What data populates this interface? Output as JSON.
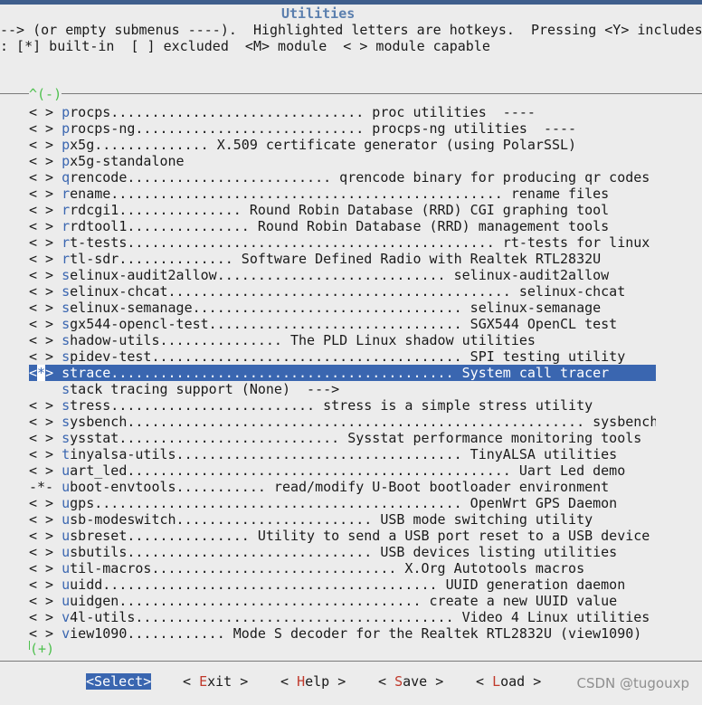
{
  "window": {
    "title": "Utilities"
  },
  "help": {
    "line1": "--> (or empty submenus ----).  Highlighted letters are hotkeys.  Pressing <Y> includes,",
    "line2": ": [*] built-in  [ ] excluded  <M> module  < > module capable"
  },
  "scroll": {
    "up_indicator": "^(-)",
    "down_indicator": "(+)"
  },
  "items": [
    {
      "prefix": "< > ",
      "hotkey": "p",
      "rest": "rocps............................... proc utilities  ----"
    },
    {
      "prefix": "< > ",
      "hotkey": "p",
      "rest": "rocps-ng............................ procps-ng utilities  ----"
    },
    {
      "prefix": "< > ",
      "hotkey": "p",
      "rest": "x5g.............. X.509 certificate generator (using PolarSSL)"
    },
    {
      "prefix": "< > ",
      "hotkey": "p",
      "rest": "x5g-standalone"
    },
    {
      "prefix": "< > ",
      "hotkey": "q",
      "rest": "rencode......................... qrencode binary for producing qr codes"
    },
    {
      "prefix": "< > ",
      "hotkey": "r",
      "rest": "ename................................................ rename files"
    },
    {
      "prefix": "< > ",
      "hotkey": "r",
      "rest": "rdcgi1............... Round Robin Database (RRD) CGI graphing tool"
    },
    {
      "prefix": "< > ",
      "hotkey": "r",
      "rest": "rdtool1............... Round Robin Database (RRD) management tools"
    },
    {
      "prefix": "< > ",
      "hotkey": "r",
      "rest": "t-tests............................................. rt-tests for linux"
    },
    {
      "prefix": "< > ",
      "hotkey": "r",
      "rest": "tl-sdr.............. Software Defined Radio with Realtek RTL2832U"
    },
    {
      "prefix": "< > ",
      "hotkey": "s",
      "rest": "elinux-audit2allow............................ selinux-audit2allow"
    },
    {
      "prefix": "< > ",
      "hotkey": "s",
      "rest": "elinux-chcat.......................................... selinux-chcat"
    },
    {
      "prefix": "< > ",
      "hotkey": "s",
      "rest": "elinux-semanage................................. selinux-semanage"
    },
    {
      "prefix": "< > ",
      "hotkey": "s",
      "rest": "gx544-opencl-test............................... SGX544 OpenCL test"
    },
    {
      "prefix": "< > ",
      "hotkey": "s",
      "rest": "hadow-utils............... The PLD Linux shadow utilities"
    },
    {
      "prefix": "< > ",
      "hotkey": "s",
      "rest": "pidev-test...................................... SPI testing utility"
    },
    {
      "prefix": "<*> ",
      "hotkey": "s",
      "rest": "trace.......................................... System call tracer",
      "selected": true
    },
    {
      "prefix": "    ",
      "hotkey": "s",
      "rest": "tack tracing support (None)  --->"
    },
    {
      "prefix": "< > ",
      "hotkey": "s",
      "rest": "tress......................... stress is a simple stress utility"
    },
    {
      "prefix": "< > ",
      "hotkey": "s",
      "rest": "ysbench........................................................ sysbench"
    },
    {
      "prefix": "< > ",
      "hotkey": "s",
      "rest": "ysstat........................... Sysstat performance monitoring tools"
    },
    {
      "prefix": "< > ",
      "hotkey": "t",
      "rest": "inyalsa-utils................................... TinyALSA utilities"
    },
    {
      "prefix": "< > ",
      "hotkey": "u",
      "rest": "art_led............................................... Uart Led demo"
    },
    {
      "prefix": "-*- ",
      "hotkey": "u",
      "rest": "boot-envtools........... read/modify U-Boot bootloader environment"
    },
    {
      "prefix": "< > ",
      "hotkey": "u",
      "rest": "gps............................................. OpenWrt GPS Daemon"
    },
    {
      "prefix": "< > ",
      "hotkey": "u",
      "rest": "sb-modeswitch........................ USB mode switching utility"
    },
    {
      "prefix": "< > ",
      "hotkey": "u",
      "rest": "sbreset............... Utility to send a USB port reset to a USB device"
    },
    {
      "prefix": "< > ",
      "hotkey": "u",
      "rest": "sbutils.............................. USB devices listing utilities"
    },
    {
      "prefix": "< > ",
      "hotkey": "u",
      "rest": "til-macros.............................. X.Org Autotools macros"
    },
    {
      "prefix": "< > ",
      "hotkey": "u",
      "rest": "uidd......................................... UUID generation daemon"
    },
    {
      "prefix": "< > ",
      "hotkey": "u",
      "rest": "uidgen..................................... create a new UUID value"
    },
    {
      "prefix": "< > ",
      "hotkey": "v",
      "rest": "4l-utils....................................... Video 4 Linux utilities"
    },
    {
      "prefix": "< > ",
      "hotkey": "v",
      "rest": "iew1090............ Mode S decoder for the Realtek RTL2832U (view1090)"
    }
  ],
  "buttons": [
    {
      "open": "<",
      "hotkey": "S",
      "rest": "elect",
      "close": ">",
      "focused": true
    },
    {
      "open": "< ",
      "hotkey": "E",
      "rest": "xit",
      "close": " >"
    },
    {
      "open": "< ",
      "hotkey": "H",
      "rest": "elp",
      "close": " >"
    },
    {
      "open": "< ",
      "hotkey": "S",
      "rest": "ave",
      "close": " >"
    },
    {
      "open": "< ",
      "hotkey": "L",
      "rest": "oad",
      "close": " >"
    }
  ],
  "watermark": "CSDN @tugouxp",
  "colors": {
    "title": "#5b7fae",
    "selection": "#3a66b0",
    "hotkey": "#3a66b0",
    "button_hotkey": "#c0392b",
    "background": "#ececec"
  }
}
